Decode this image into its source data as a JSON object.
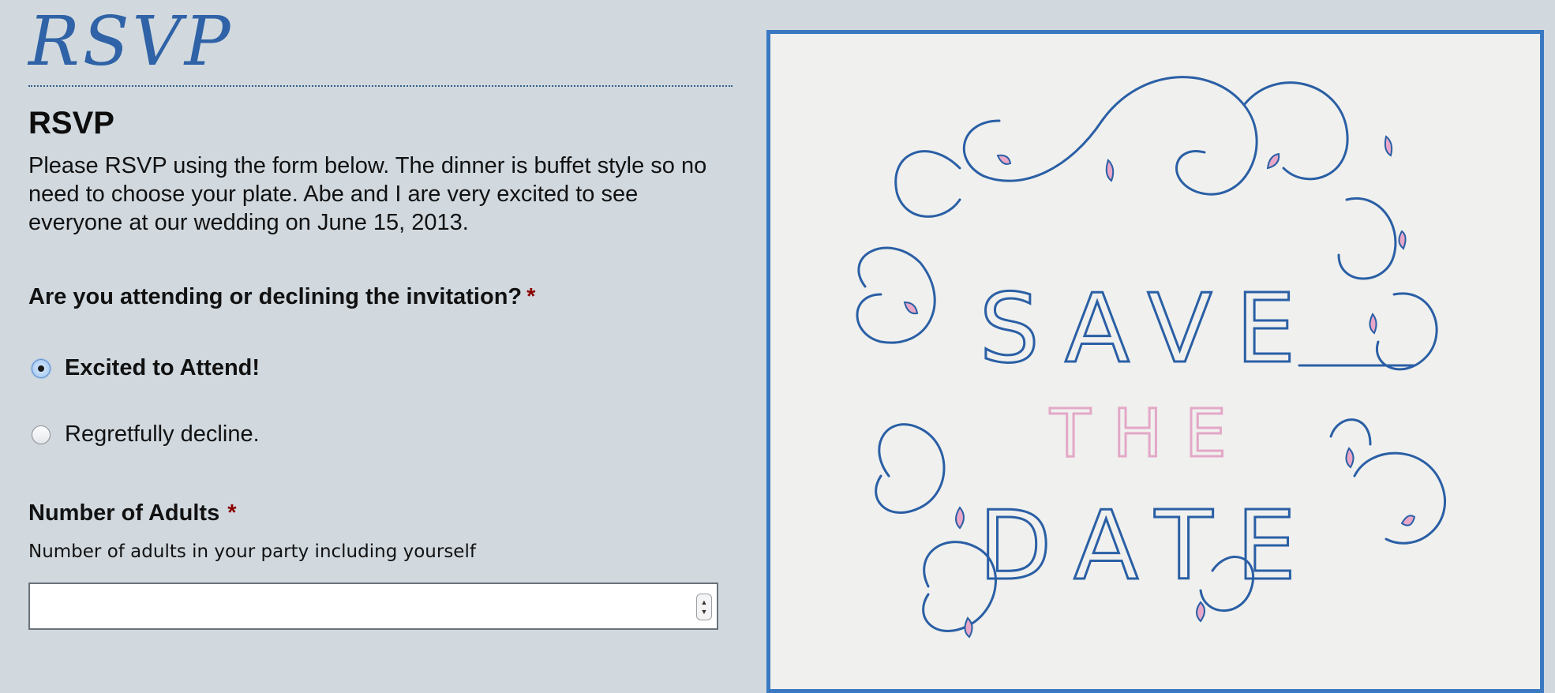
{
  "header": {
    "script_title": "RSVP",
    "heading": "RSVP",
    "intro": "Please RSVP using the form below. The dinner is buffet style so no need to choose your plate. Abe and I are very excited to see everyone at our wedding on June 15, 2013."
  },
  "attendance": {
    "label": "Are you attending or declining the invitation?",
    "required_mark": "*",
    "options": [
      {
        "label": "Excited to Attend!",
        "checked": true
      },
      {
        "label": "Regretfully decline.",
        "checked": false
      }
    ]
  },
  "adults": {
    "label": "Number of Adults",
    "required_mark": "*",
    "help": "Number of adults in your party including yourself",
    "value": "",
    "placeholder": ""
  },
  "card": {
    "line1": "SAVE",
    "line2": "THE",
    "line3": "DATE"
  },
  "colors": {
    "background": "#d1d9df",
    "accent_blue": "#2f62a6",
    "card_border": "#3a78c2",
    "required": "#8b0000",
    "pink": "#e8a6c8"
  }
}
